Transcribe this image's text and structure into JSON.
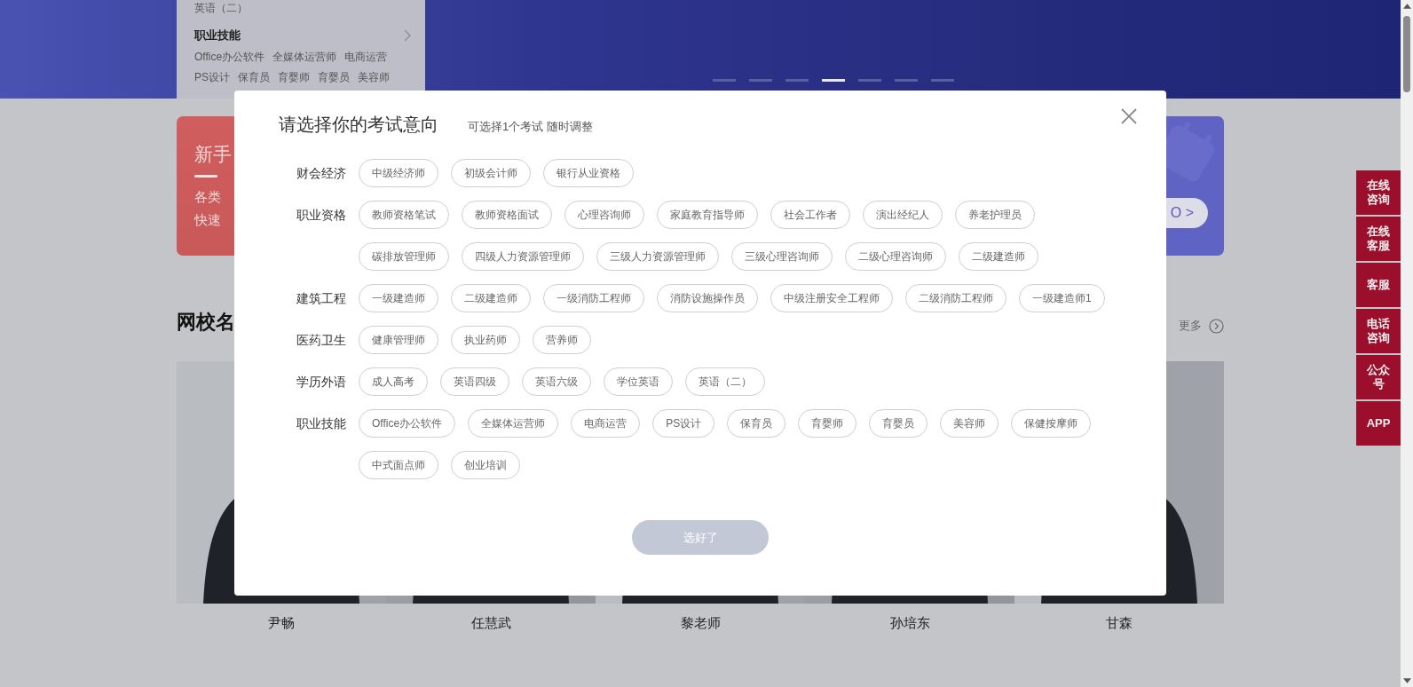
{
  "banner": {
    "menu": [
      {
        "kind": "link",
        "label": "英语（二）"
      },
      {
        "kind": "heading",
        "label": "职业技能"
      },
      {
        "kind": "links",
        "items": [
          "Office办公软件",
          "全媒体运营师",
          "电商运营"
        ]
      },
      {
        "kind": "links",
        "items": [
          "PS设计",
          "保育员",
          "育婴师",
          "育婴员",
          "美容师"
        ]
      }
    ],
    "dots": [
      {
        "selected": false
      },
      {
        "selected": false
      },
      {
        "selected": false
      },
      {
        "selected": true
      },
      {
        "selected": false
      },
      {
        "selected": false
      },
      {
        "selected": false
      }
    ]
  },
  "promo_cards": [
    {
      "kind": "newbie",
      "title": "新手",
      "lines": [
        "各类",
        "快速"
      ]
    },
    {
      "kind": "calendar",
      "button": "O >"
    }
  ],
  "section": {
    "title": "网校名",
    "more": "更多"
  },
  "teachers": [
    {
      "name": "尹畅"
    },
    {
      "name": "任慧武"
    },
    {
      "name": "黎老师"
    },
    {
      "name": "孙培东"
    },
    {
      "name": "甘森"
    }
  ],
  "float_bar": [
    "在线咨询",
    "在线客服",
    "客服",
    "电话咨询",
    "公众号",
    "APP"
  ],
  "modal": {
    "title": "请选择你的考试意向",
    "subtitle": "可选择1个考试 随时调整",
    "categories": [
      {
        "label": "财会经济",
        "tags": [
          {
            "label": "中级经济师",
            "selected": false
          },
          {
            "label": "初级会计师",
            "selected": false
          },
          {
            "label": "银行从业资格",
            "selected": false
          }
        ]
      },
      {
        "label": "职业资格",
        "tags": [
          {
            "label": "教师资格笔试",
            "selected": false
          },
          {
            "label": "教师资格面试",
            "selected": false
          },
          {
            "label": "心理咨询师",
            "selected": false
          },
          {
            "label": "家庭教育指导师",
            "selected": false
          },
          {
            "label": "社会工作者",
            "selected": false
          },
          {
            "label": "演出经纪人",
            "selected": false
          },
          {
            "label": "养老护理员",
            "selected": false
          },
          {
            "label": "碳排放管理师",
            "selected": false
          },
          {
            "label": "四级人力资源管理师",
            "selected": false
          },
          {
            "label": "三级人力资源管理师",
            "selected": false
          },
          {
            "label": "三级心理咨询师",
            "selected": false
          },
          {
            "label": "二级心理咨询师",
            "selected": false
          },
          {
            "label": "二级建造师",
            "selected": false
          }
        ]
      },
      {
        "label": "建筑工程",
        "tags": [
          {
            "label": "一级建造师",
            "selected": false
          },
          {
            "label": "二级建造师",
            "selected": false
          },
          {
            "label": "一级消防工程师",
            "selected": false
          },
          {
            "label": "消防设施操作员",
            "selected": false
          },
          {
            "label": "中级注册安全工程师",
            "selected": false
          },
          {
            "label": "二级消防工程师",
            "selected": false
          },
          {
            "label": "一级建造师1",
            "selected": false
          }
        ]
      },
      {
        "label": "医药卫生",
        "tags": [
          {
            "label": "健康管理师",
            "selected": false
          },
          {
            "label": "执业药师",
            "selected": false
          },
          {
            "label": "营养师",
            "selected": false
          }
        ]
      },
      {
        "label": "学历外语",
        "tags": [
          {
            "label": "成人高考",
            "selected": false
          },
          {
            "label": "英语四级",
            "selected": false
          },
          {
            "label": "英语六级",
            "selected": false
          },
          {
            "label": "学位英语",
            "selected": false
          },
          {
            "label": "英语（二）",
            "selected": false
          }
        ]
      },
      {
        "label": "职业技能",
        "tags": [
          {
            "label": "Office办公软件",
            "selected": false
          },
          {
            "label": "全媒体运营师",
            "selected": false
          },
          {
            "label": "电商运营",
            "selected": false
          },
          {
            "label": "PS设计",
            "selected": false
          },
          {
            "label": "保育员",
            "selected": false
          },
          {
            "label": "育婴师",
            "selected": false
          },
          {
            "label": "育婴员",
            "selected": false
          },
          {
            "label": "美容师",
            "selected": false
          },
          {
            "label": "保健按摩师",
            "selected": false
          },
          {
            "label": "中式面点师",
            "selected": false
          },
          {
            "label": "创业培训",
            "selected": false
          }
        ]
      }
    ],
    "confirm": {
      "label": "选好了",
      "disabled": true
    }
  }
}
